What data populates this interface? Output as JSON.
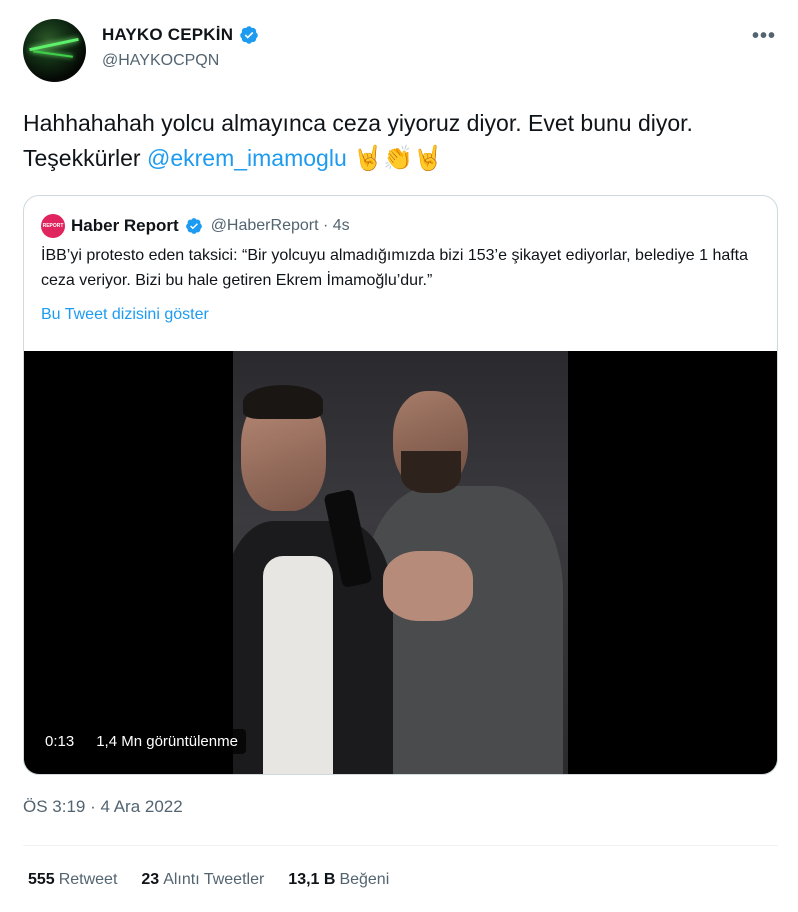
{
  "author": {
    "display_name": "HAYKO CEPKİN",
    "handle": "@HAYKOCPQN",
    "verified_icon": "verified-badge-icon"
  },
  "more_label": "•••",
  "tweet": {
    "text_before": "Hahhahahah yolcu almayınca ceza yiyoruz diyor. Evet bunu diyor. Teşekkürler ",
    "mention": "@ekrem_imamoglu",
    "emojis": " 🤘👏🤘"
  },
  "quote": {
    "avatar_text": "REPORT",
    "name": "Haber Report",
    "handle": "@HaberReport · 4s",
    "text": "İBB’yi protesto eden taksici: “Bir yolcuyu almadığımızda bizi 153’e şikayet ediyorlar, belediye 1 hafta ceza veriyor. Bizi bu hale getiren Ekrem İmamoğlu’dur.”",
    "thread_link": "Bu Tweet dizisini göster",
    "video": {
      "duration": "0:13",
      "views": "1,4 Mn görüntülenme"
    }
  },
  "timestamp": "ÖS 3:19 · 4 Ara 2022",
  "stats": {
    "retweets_count": "555",
    "retweets_label": "Retweet",
    "quotes_count": "23",
    "quotes_label": "Alıntı Tweetler",
    "likes_count": "13,1 B",
    "likes_label": "Beğeni"
  },
  "colors": {
    "accent": "#1d9bf0",
    "secondary_text": "#536471",
    "border": "#cfd9de"
  }
}
